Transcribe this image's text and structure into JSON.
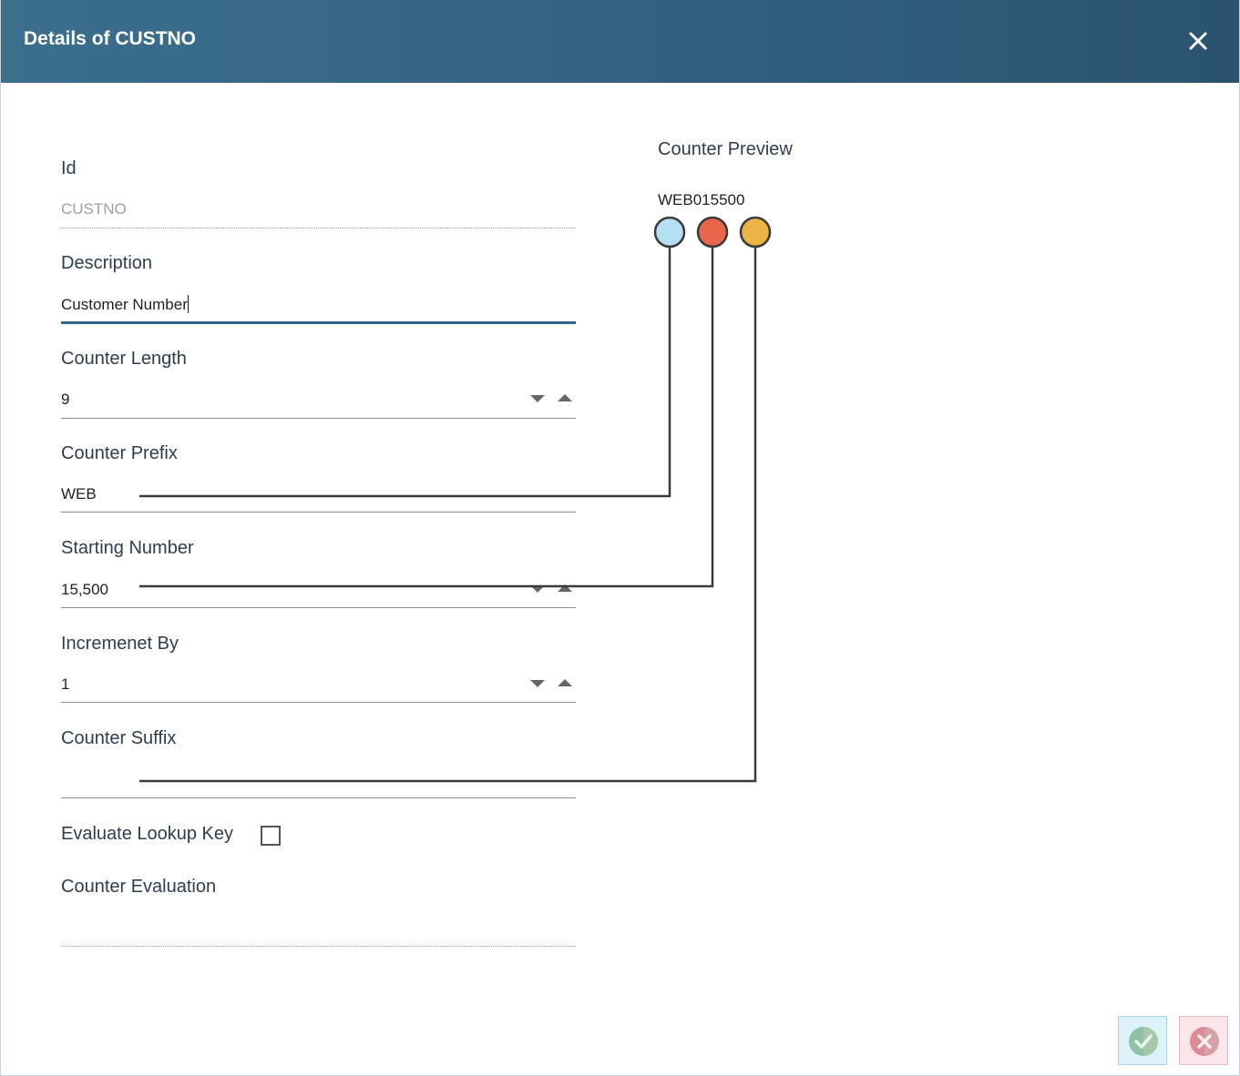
{
  "dialog": {
    "title": "Details of CUSTNO"
  },
  "form": {
    "id_label": "Id",
    "id_value": "CUSTNO",
    "description_label": "Description",
    "description_value": "Customer Number",
    "counter_length_label": "Counter Length",
    "counter_length_value": "9",
    "counter_prefix_label": "Counter Prefix",
    "counter_prefix_value": "WEB",
    "starting_number_label": "Starting Number",
    "starting_number_value": "15,500",
    "increment_label": "Incremenet By",
    "increment_value": "1",
    "counter_suffix_label": "Counter Suffix",
    "counter_suffix_value": "",
    "evaluate_lookup_label": "Evaluate Lookup Key",
    "evaluate_lookup_checked": false,
    "counter_evaluation_label": "Counter Evaluation",
    "counter_evaluation_value": ""
  },
  "preview": {
    "title": "Counter Preview",
    "value": "WEB015500",
    "markers": [
      {
        "part": "prefix",
        "color": "#b3e0f2"
      },
      {
        "part": "number",
        "color": "#e8674a"
      },
      {
        "part": "suffix",
        "color": "#ebb444"
      }
    ]
  },
  "icons": {
    "close": "close-icon",
    "ok": "check-icon",
    "cancel": "cancel-icon"
  },
  "colors": {
    "header_start": "#3b6f8e",
    "header_end": "#2a5470",
    "focus_underline": "#2f6690"
  }
}
